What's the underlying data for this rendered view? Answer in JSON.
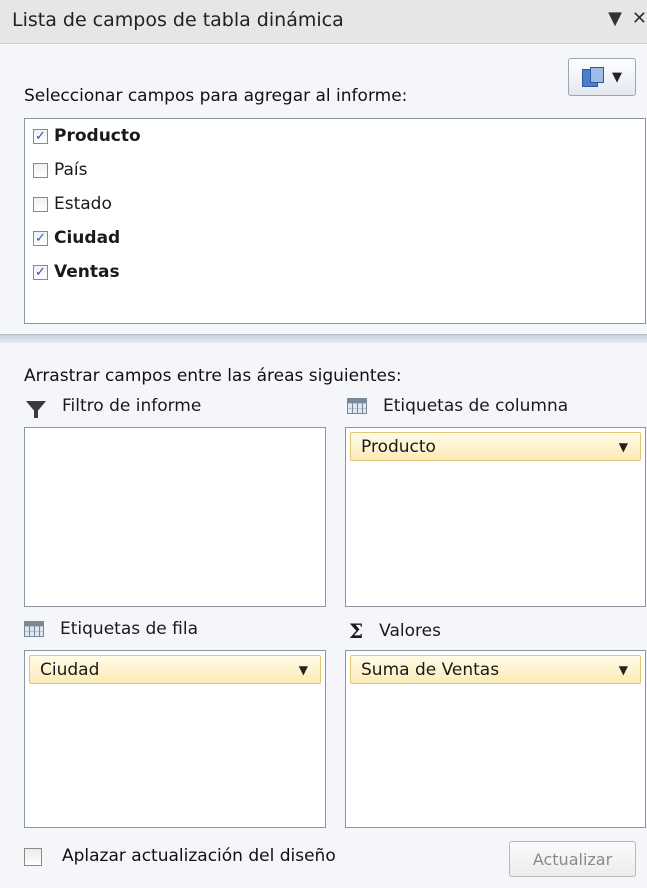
{
  "pane": {
    "title": "Lista de campos de tabla dinámica",
    "menu_arrow": "▼",
    "close_glyph": "✕"
  },
  "fields": {
    "prompt": "Seleccionar campos para agregar al informe:",
    "items": [
      {
        "label": "Producto",
        "checked": true
      },
      {
        "label": "País",
        "checked": false
      },
      {
        "label": "Estado",
        "checked": false
      },
      {
        "label": "Ciudad",
        "checked": true
      },
      {
        "label": "Ventas",
        "checked": true
      }
    ]
  },
  "areas": {
    "prompt": "Arrastrar campos entre las áreas siguientes:",
    "report_filter": {
      "label": "Filtro de informe"
    },
    "column_labels": {
      "label": "Etiquetas de columna",
      "field": "Producto"
    },
    "row_labels": {
      "label": "Etiquetas de fila",
      "field": "Ciudad"
    },
    "values": {
      "label": "Valores",
      "field": "Suma de Ventas",
      "icon": "Σ"
    }
  },
  "footer": {
    "defer_label": "Aplazar actualización del diseño",
    "defer_checked": false,
    "update_label": "Actualizar"
  },
  "colors": {
    "pill_border": "#e3c575",
    "pill_fill": "#fbebb7",
    "checkmark": "#2a56b5",
    "panel_bg": "#f4f6f9"
  }
}
